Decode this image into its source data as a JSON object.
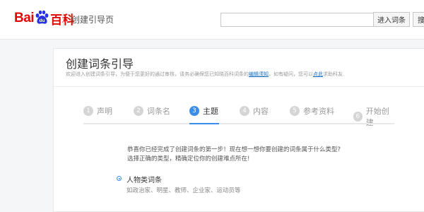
{
  "header": {
    "logo_text_bai": "Bai",
    "logo_text_du": "du",
    "logo_text_baike": "百科",
    "page_name": "创建引导页",
    "search": {
      "value": "",
      "placeholder": ""
    },
    "enter_button": "进入词条",
    "cut_button": "搜"
  },
  "card": {
    "title": "创建词条引导",
    "desc_prefix": "欢迎进入创建词条引导，为便于您更好的通过审核，请务必确保您已知晓百科词条的",
    "desc_link1": "编辑须知",
    "desc_middle": "，如有疑问，您可以",
    "desc_link2": "点此",
    "desc_suffix": "求助科友"
  },
  "steps": [
    {
      "num": "1",
      "label": "声明",
      "active": false
    },
    {
      "num": "2",
      "label": "词条名",
      "active": false
    },
    {
      "num": "3",
      "label": "主题",
      "active": true
    },
    {
      "num": "4",
      "label": "内容",
      "active": false
    },
    {
      "num": "5",
      "label": "参考资料",
      "active": false
    },
    {
      "num": "6",
      "label": "开始创建",
      "active": false
    }
  ],
  "intro": {
    "line1": "恭喜你已经完成了创建词条的第一步！现在想一想你要创建的词条属于什么类型?",
    "line2": "选择正确的类型，精确定位你的创建难点所在!"
  },
  "option": {
    "label": "人物类词条",
    "examples": "如政治家、明星、教师、企业家、运动员等",
    "selected": true
  },
  "colors": {
    "brand_red": "#e10601",
    "brand_blue": "#2932e1",
    "accent": "#3b8ee8"
  }
}
